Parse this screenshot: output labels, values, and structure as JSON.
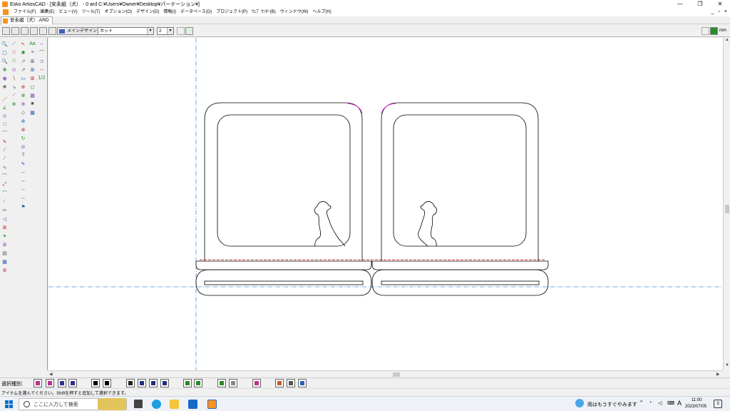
{
  "window": {
    "title": "Esko ArtiosCAD - [安永組（犬） - 0 ard C:¥Users¥Owner¥Desktop¥パーテーション¥]",
    "controls": [
      "—",
      "❐",
      "✕"
    ]
  },
  "menu": {
    "items": [
      "ファイル(F)",
      "編集(E)",
      "ビュー(V)",
      "ツール(T)",
      "オプション(O)",
      "デザイン(D)",
      "情報(I)",
      "データベース(D)",
      "プロジェクト(P)",
      "ｳｪﾌﾞ ｾﾝﾀｰ(B)",
      "ウィンドウ(W)",
      "ヘルプ(H)"
    ],
    "mdi_controls": [
      "_",
      "▫",
      "×"
    ]
  },
  "document_tab": {
    "label": "安永組（犬）.ARD"
  },
  "toolbar": {
    "main_design_label": "メインデザイン",
    "line_type_value": "カット",
    "line_width_value": "2",
    "units_label": "mm"
  },
  "status": {
    "selection_label": "選択種別:",
    "hint": "アイテムを選んでください。Shiftを押すと追加して選択できます。"
  },
  "taskbar": {
    "search_placeholder": "ここに入力して検索",
    "weather": "雨はもうすぐやみます",
    "time": "11:00",
    "date": "2023/07/05",
    "ime": "A",
    "notifications": "3"
  },
  "colors": {
    "accent": "#f7941d",
    "cut_line": "#000000",
    "crease_line": "#c00000",
    "guide_line": "#4a90d9",
    "cut_accent": "#cc33cc"
  }
}
